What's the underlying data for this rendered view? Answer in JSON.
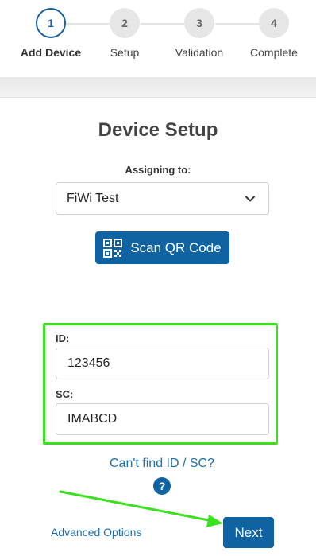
{
  "stepper": {
    "steps": [
      {
        "number": "1",
        "label": "Add Device",
        "state": "active"
      },
      {
        "number": "2",
        "label": "Setup",
        "state": "inactive"
      },
      {
        "number": "3",
        "label": "Validation",
        "state": "inactive"
      },
      {
        "number": "4",
        "label": "Complete",
        "state": "inactive"
      }
    ]
  },
  "main": {
    "title": "Device Setup",
    "assign_label": "Assigning to:",
    "assign_value": "FiWi Test",
    "scan_label": "Scan QR Code",
    "id_label": "ID:",
    "id_value": "123456",
    "sc_label": "SC:",
    "sc_value": "IMABCD",
    "help_link": "Can't find ID / SC?",
    "help_icon": "?"
  },
  "footer": {
    "advanced_label": "Advanced Options",
    "next_label": "Next"
  },
  "icons": {
    "select_chevron": "chevron-down-icon",
    "scan": "qr-code-icon",
    "help": "question-circle-icon"
  },
  "colors": {
    "primary": "#0f63a3",
    "link": "#1a6fb0",
    "highlight": "#3be01e"
  }
}
